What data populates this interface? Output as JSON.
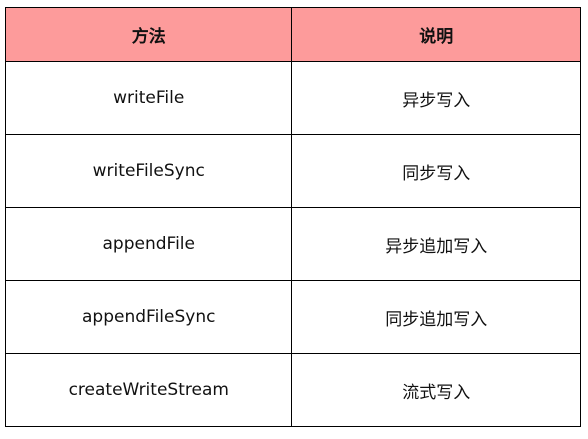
{
  "table": {
    "headers": {
      "method": "方法",
      "description": "说明"
    },
    "rows": [
      {
        "method": "writeFile",
        "description": "异步写入"
      },
      {
        "method": "writeFileSync",
        "description": "同步写入"
      },
      {
        "method": "appendFile",
        "description": "异步追加写入"
      },
      {
        "method": "appendFileSync",
        "description": "同步追加写入"
      },
      {
        "method": "createWriteStream",
        "description": "流式写入"
      }
    ]
  },
  "colors": {
    "header_background": "#fd9b9b",
    "border": "#000000",
    "text": "#111111"
  }
}
